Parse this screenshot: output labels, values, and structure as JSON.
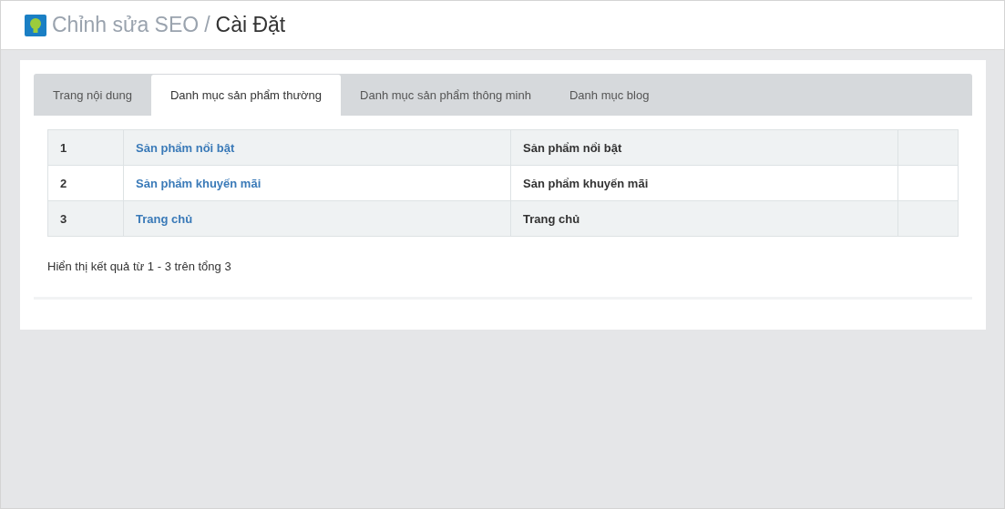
{
  "header": {
    "section": "Chỉnh sửa SEO",
    "separator": "/",
    "page": "Cài Đặt"
  },
  "tabs": [
    {
      "label": "Trang nội dung",
      "selected": false
    },
    {
      "label": "Danh mục sản phẩm thường",
      "selected": true
    },
    {
      "label": "Danh mục sản phẩm thông minh",
      "selected": false
    },
    {
      "label": "Danh mục blog",
      "selected": false
    }
  ],
  "table": {
    "rows": [
      {
        "index": "1",
        "link": "Sản phẩm nổi bật",
        "name": "Sản phẩm nổi bật"
      },
      {
        "index": "2",
        "link": "Sản phẩm khuyến mãi",
        "name": "Sản phẩm khuyến mãi"
      },
      {
        "index": "3",
        "link": "Trang chủ",
        "name": "Trang chủ"
      }
    ]
  },
  "summary": "Hiển thị kết quả từ 1 - 3 trên tổng 3"
}
